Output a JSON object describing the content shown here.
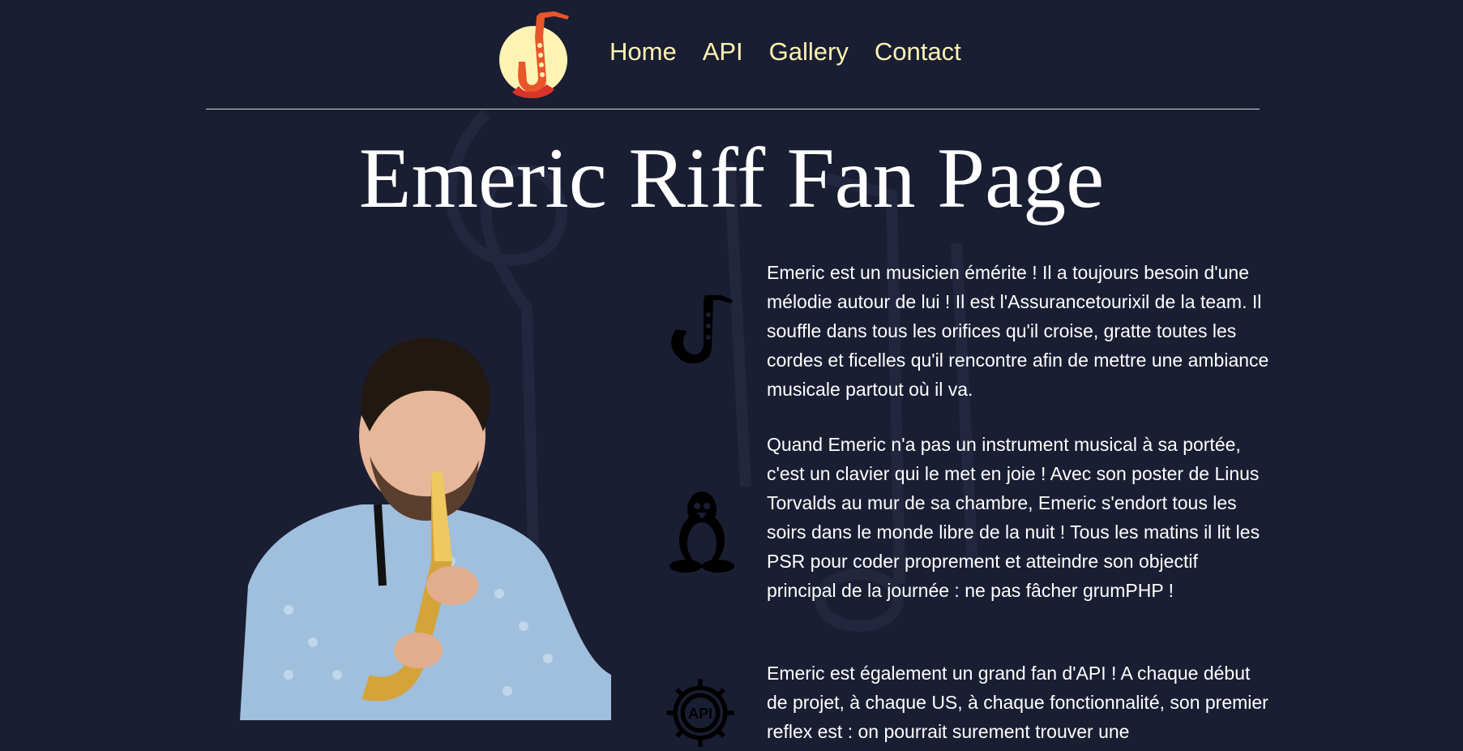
{
  "nav": {
    "logo_icon": "saxophone-logo-icon",
    "links": [
      {
        "label": "Home"
      },
      {
        "label": "API"
      },
      {
        "label": "Gallery"
      },
      {
        "label": "Contact"
      }
    ]
  },
  "page_title": "Emeric Riff Fan Page",
  "photo": {
    "description_icon": "saxophone-player-photo"
  },
  "sections": [
    {
      "icon": "saxophone-icon",
      "text": "Emeric est un musicien émérite ! Il a toujours besoin d'une mélodie autour de lui ! Il est l'Assurancetourixil de la team. Il souffle dans tous les orifices qu'il croise, gratte toutes les cordes et ficelles qu'il rencontre afin de mettre une ambiance musicale partout où il va."
    },
    {
      "icon": "linux-penguin-icon",
      "text": "Quand Emeric n'a pas un instrument musical à sa portée, c'est un clavier qui le met en joie ! Avec son poster de Linus Torvalds au mur de sa chambre, Emeric s'endort tous les soirs dans le monde libre de la nuit ! Tous les matins il lit les PSR pour coder proprement et atteindre son objectif principal de la journée : ne pas fâcher grumPHP !"
    },
    {
      "icon": "api-gear-icon",
      "icon_label": "API",
      "text": "Emeric est également un grand fan d'API ! A chaque début de projet, à chaque US, à chaque fonctionnalité, son premier reflex est : on pourrait surement trouver une"
    }
  ],
  "colors": {
    "background": "#1a1e33",
    "nav_link": "#fff3b3",
    "text": "#ffffff",
    "logo_circle": "#fff3b3",
    "logo_sax": "#e8562a"
  }
}
